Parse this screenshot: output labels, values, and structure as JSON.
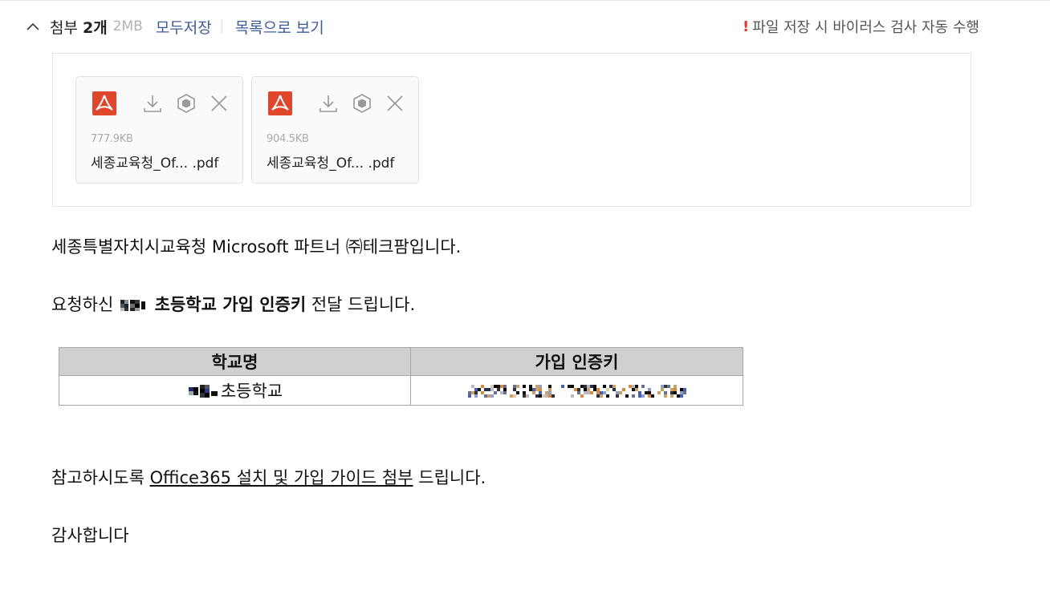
{
  "attachments": {
    "title": "첨부",
    "count": "2개",
    "total_size": "2MB",
    "save_all_label": "모두저장",
    "list_view_label": "목록으로 보기",
    "virus_notice": "파일 저장 시 바이러스 검사 자동 수행",
    "virus_notice_mark": "!",
    "files": [
      {
        "size": "777.9KB",
        "name": "세종교육청_Of... .pdf"
      },
      {
        "size": "904.5KB",
        "name": "세종교육청_Of... .pdf"
      }
    ]
  },
  "message": {
    "line1": "세종특별자치시교육청 Microsoft 파트너 ㈜테크팜입니다.",
    "line2_prefix": "요청하신 ",
    "line2_bold": "초등학교 가입 인증키",
    "line2_suffix": " 전달 드립니다.",
    "table": {
      "headers": [
        "학교명",
        "가입 인증키"
      ],
      "school_suffix": "초등학교"
    },
    "line3_prefix": "참고하시도록 ",
    "line3_link": "Office365 설치 및 가입 가이드 첨부",
    "line3_suffix": " 드립니다.",
    "line4": "감사합니다"
  },
  "colors": {
    "link": "#3e5c99",
    "pdf_red": "#e0462b",
    "notice_red": "#e8332b",
    "table_header_bg": "#d0d0d0"
  },
  "icons": {
    "toggle": "chevron-up-icon",
    "file_type": "pdf-icon",
    "download": "download-icon",
    "virus_scan": "cube-icon",
    "remove": "close-icon"
  }
}
